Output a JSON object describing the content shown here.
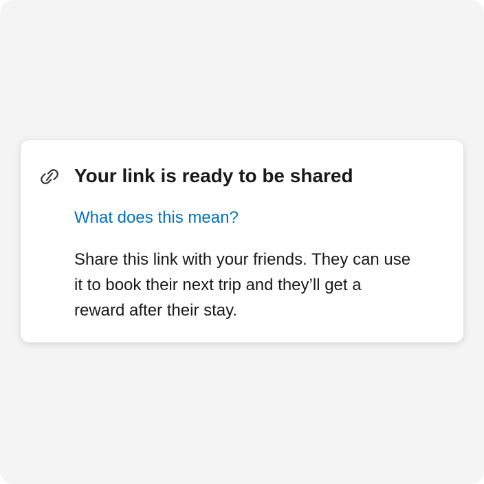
{
  "card": {
    "icon": "link-icon",
    "title": "Your link is ready to be shared",
    "help_link": "What does this mean?",
    "description": "Share this link with your friends. They can use it to book their next trip and they’ll get a reward after their stay."
  },
  "colors": {
    "background": "#f4f4f4",
    "card": "#ffffff",
    "text": "#1a1a1a",
    "link": "#0071c2"
  }
}
